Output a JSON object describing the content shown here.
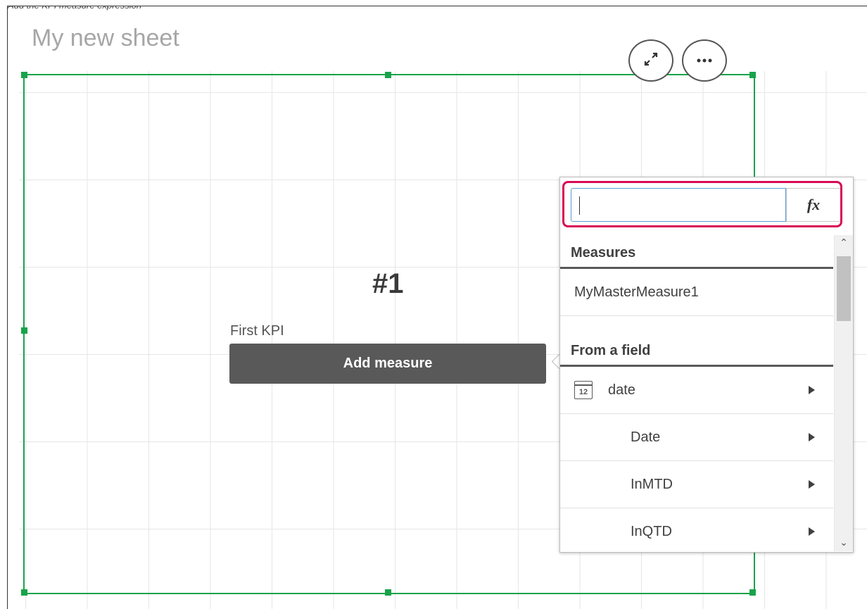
{
  "caption": "Add the KPI measure expression",
  "sheet": {
    "title": "My new sheet"
  },
  "toolbar": {
    "expand_icon": "expand-icon",
    "more_icon": "more-options-icon"
  },
  "kpi": {
    "value": "#1",
    "label": "First KPI",
    "add_measure_label": "Add measure"
  },
  "popover": {
    "search": {
      "value": "",
      "placeholder": ""
    },
    "fx_label": "fx",
    "sections": [
      {
        "header": "Measures",
        "items": [
          {
            "label": "MyMasterMeasure1"
          }
        ]
      },
      {
        "header": "From a field",
        "items": [
          {
            "label": "date",
            "icon": "calendar-icon",
            "icon_text": "12"
          },
          {
            "label": "Date"
          },
          {
            "label": "InMTD"
          },
          {
            "label": "InQTD"
          }
        ]
      }
    ]
  },
  "colors": {
    "selection_border": "#18a34a",
    "search_highlight": "#d90a55",
    "add_measure_bg": "#595959",
    "title_gray": "#a6a6a6"
  }
}
